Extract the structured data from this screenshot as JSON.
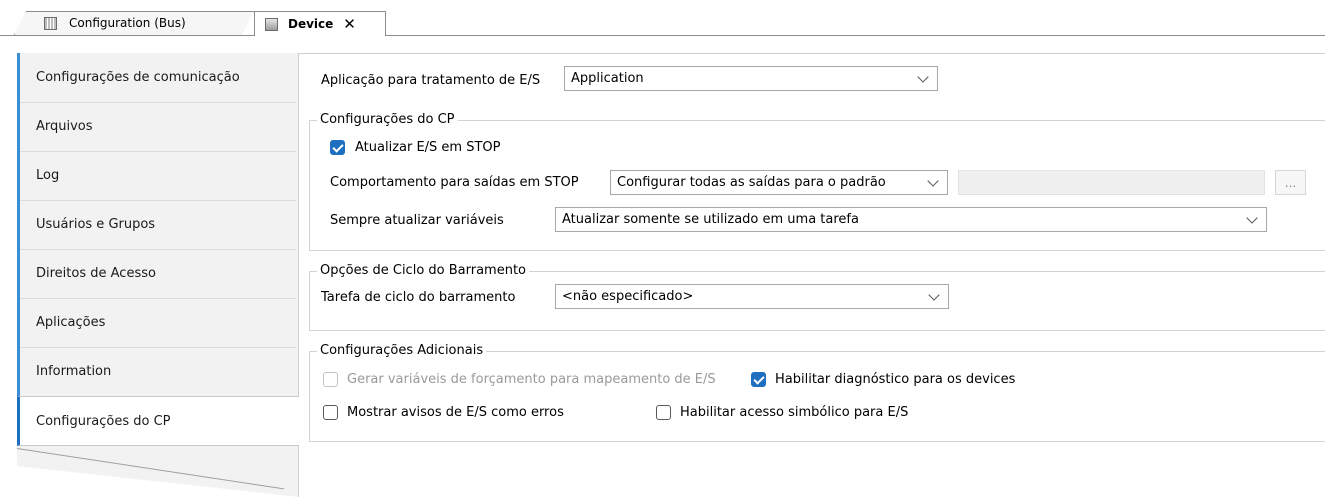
{
  "tabs": [
    {
      "label": "Configuration (Bus)",
      "icon": "grid-document-icon"
    },
    {
      "label": "Device",
      "icon": "device-icon",
      "close": "✕"
    }
  ],
  "sidebar": {
    "items": [
      {
        "label": "Configurações de comunicação"
      },
      {
        "label": "Arquivos"
      },
      {
        "label": "Log"
      },
      {
        "label": "Usuários e Grupos"
      },
      {
        "label": "Direitos de Acesso"
      },
      {
        "label": "Aplicações"
      },
      {
        "label": "Information"
      },
      {
        "label": "Configurações do CP"
      }
    ]
  },
  "app_io": {
    "label": "Aplicação para tratamento de E/S",
    "value": "Application"
  },
  "cp_settings": {
    "title": "Configurações do CP",
    "update_io_stop": {
      "label": "Atualizar E/S em STOP",
      "checked": true
    },
    "outputs_stop": {
      "label": "Comportamento para saídas em STOP",
      "value": "Configurar todas as saídas para o padrão",
      "browse": "..."
    },
    "always_update": {
      "label": "Sempre atualizar variáveis",
      "value": "Atualizar somente se utilizado em uma tarefa"
    }
  },
  "bus_cycle": {
    "title": "Opções de Ciclo do Barramento",
    "task_label": "Tarefa de ciclo do barramento",
    "task_value": "<não especificado>"
  },
  "additional": {
    "title": "Configurações Adicionais",
    "force_vars": {
      "label": "Gerar variáveis de forçamento para mapeamento de E/S",
      "checked": false,
      "disabled": true
    },
    "diag": {
      "label": "Habilitar diagnóstico para os devices",
      "checked": true
    },
    "warnings": {
      "label": "Mostrar avisos de E/S como erros",
      "checked": false
    },
    "symbolic": {
      "label": "Habilitar acesso simbólico para E/S",
      "checked": false
    }
  },
  "colors": {
    "accent": "#1f6fc0",
    "sidebar_marker": "#3b90d3",
    "sidebar_bg": "#f2f2f2"
  }
}
